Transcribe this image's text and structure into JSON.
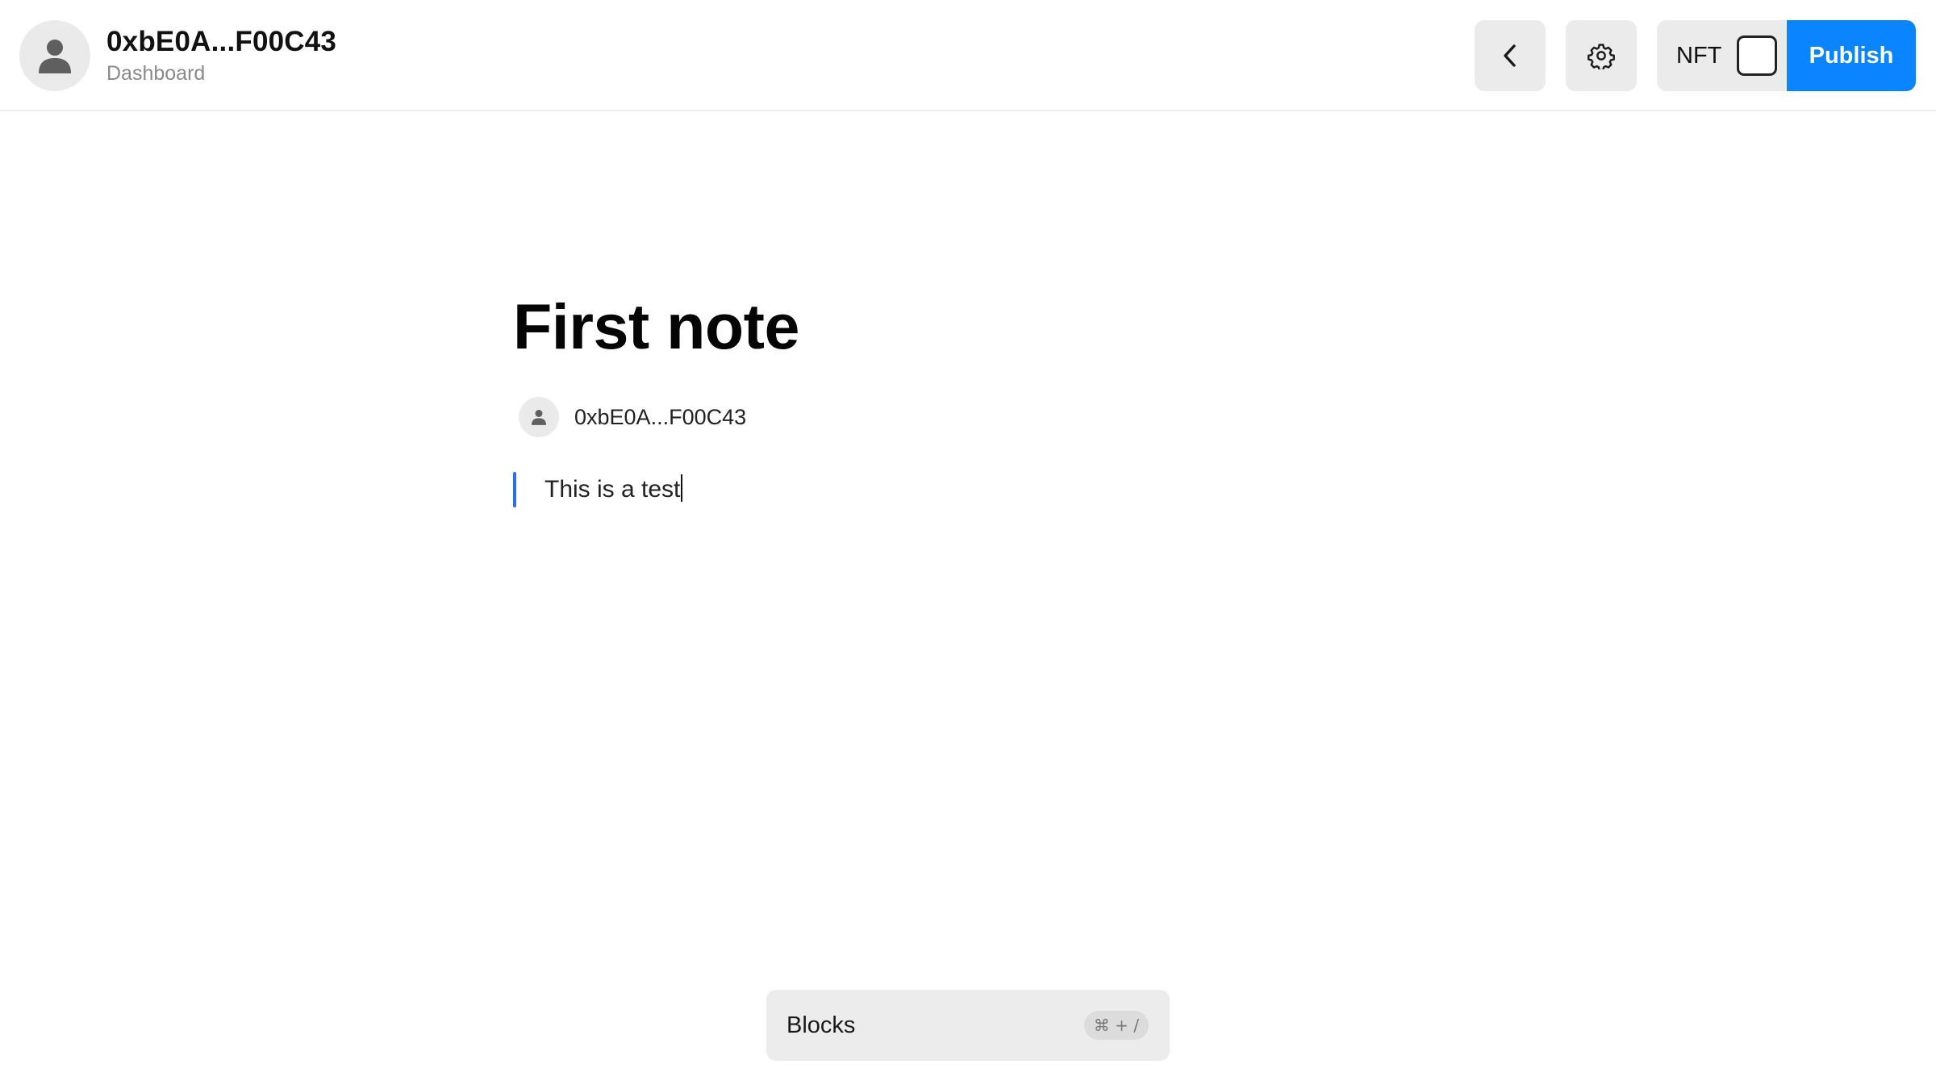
{
  "header": {
    "account_name": "0xbE0A...F00C43",
    "account_subtitle": "Dashboard",
    "nft_label": "NFT",
    "nft_checked": false,
    "publish_label": "Publish",
    "icons": {
      "avatar": "user-icon",
      "back": "chevron-left-icon",
      "settings": "gear-icon"
    }
  },
  "note": {
    "title": "First note",
    "author": "0xbE0A...F00C43",
    "body_text": "This is a test"
  },
  "blocks_bar": {
    "label": "Blocks",
    "shortcut": "⌘ + /"
  },
  "colors": {
    "accent": "#0a84ff",
    "block_indicator": "#2d6fe0",
    "button_bg": "#ebebeb"
  }
}
